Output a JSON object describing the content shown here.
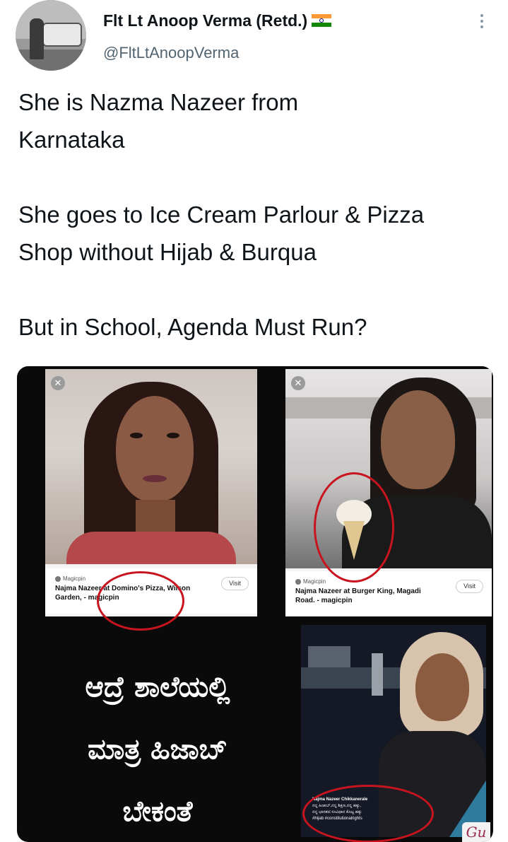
{
  "author": {
    "display_name": "Flt Lt Anoop Verma (Retd.)",
    "handle": "@FltLtAnoopVerma",
    "flag": "india-flag-icon"
  },
  "tweet": {
    "lines": [
      "She is Nazma Nazeer from Karnataka",
      "She goes to Ice Cream Parlour & Pizza Shop without Hijab & Burqua",
      "But in School, Agenda Must Run?"
    ]
  },
  "media": {
    "card1": {
      "source": "Magicpin",
      "caption": "Najma Nazeer at Domino's Pizza, Wilson Garden, - magicpin",
      "visit": "Visit"
    },
    "card2": {
      "source": "Magicpin",
      "caption": "Najma Nazeer at Burger King, Magadi Road. - magicpin",
      "visit": "Visit"
    },
    "kannada_text": "ಆದ್ರೆ ಶಾಲೆಯಲ್ಲಿ ಮಾತ್ರ ಹಿಜಾಬ್ ಬೇಕಂತೆ",
    "kannada_lines": [
      "ಆದ್ರೆ ಶಾಲೆಯಲ್ಲಿ",
      "ಮಾತ್ರ ಹಿಜಾಬ್",
      "ಬೇಕಂತೆ"
    ],
    "card3_caption": {
      "title": "Najma Nazeer Chikkanerale",
      "line2": "ನನ್ನ ಹಿಜಾಬ್,ನನ್ನ ಶಿಕ್ಷಣ,ನನ್ನ ಹಕ್ಕು,",
      "line3": "ನನ್ನ ಭಾರತದ ಸಂವಿಧಾನ ಕೊಟ್ಟ ಹಕ್ಕು",
      "tags": "#hijab #constitutionalrights"
    },
    "watermark": "Gu"
  },
  "colors": {
    "text": "#0f1419",
    "secondary": "#536471",
    "red_circle": "#c8141e"
  }
}
